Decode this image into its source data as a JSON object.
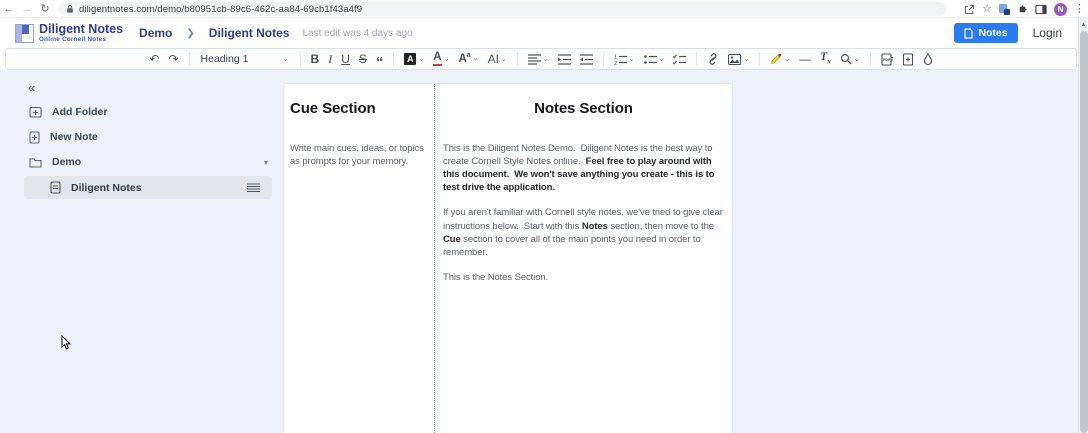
{
  "browser": {
    "url": "diligentnotes.com/demo/b80951cb-89c6-462c-aa84-69cb1f43a4f9",
    "back_glyph": "←",
    "forward_glyph": "→",
    "reload_glyph": "↻",
    "star_glyph": "☆",
    "menu_glyph": "⋮",
    "avatar_letter": "N"
  },
  "header": {
    "logo_title": "Diligent Notes",
    "logo_subtitle": "Online Cornell Notes",
    "breadcrumb": {
      "folder": "Demo",
      "separator": "❯",
      "note": "Diligent Notes"
    },
    "last_edit": "Last edit was 4 days ago",
    "notes_button_label": "Notes",
    "login_label": "Login"
  },
  "toolbar": {
    "undo_glyph": "↶",
    "redo_glyph": "↷",
    "chevron_glyph": "⌄",
    "heading_select_value": "Heading 1",
    "bold_glyph": "B",
    "italic_glyph": "I",
    "underline_glyph": "U",
    "strikethrough_glyph": "S",
    "blockquote_glyph": "“",
    "font_bg_glyph": "A",
    "font_color_glyph": "A",
    "font_size_main": "A",
    "font_size_sup": "a",
    "font_family_glyph": "AI",
    "hr_glyph": "—",
    "clear_format_main": "T",
    "clear_format_sub": "x"
  },
  "sidebar": {
    "collapse_glyph": "«",
    "add_folder_label": "Add Folder",
    "new_note_label": "New Note",
    "folder_label": "Demo",
    "folder_chevron_glyph": "▾",
    "note_label": "Diligent Notes"
  },
  "document": {
    "cue": {
      "heading": "Cue Section",
      "body": "Write main cues, ideas, or topics as prompts for your memory."
    },
    "notes": {
      "heading": "Notes Section",
      "paragraphs": [
        [
          {
            "text": "This is the Diligent Notes Demo.  Diligent Notes is the best way to create Cornell Style Notes online.  ",
            "bold": false
          },
          {
            "text": "Feel free to play around with this document.  We won't save anything you create - this is to test drive the application.",
            "bold": true
          }
        ],
        [
          {
            "text": "If you aren't familiar with Cornell style notes, we've tried to give clear instructions below.  Start with this ",
            "bold": false
          },
          {
            "text": "Notes",
            "bold": true
          },
          {
            "text": " section, then move to the ",
            "bold": false
          },
          {
            "text": "Cue",
            "bold": true
          },
          {
            "text": " section to cover all of the main points you need in order to remember.",
            "bold": false
          }
        ],
        [
          {
            "text": "This is the Notes Section.",
            "bold": false
          }
        ]
      ]
    }
  },
  "colors": {
    "accent_blue": "#2b7cf0",
    "logo_blue": "#2c3b9c",
    "avatar_purple": "#9a57c1",
    "content_bg": "#eef1f7",
    "selected_row_bg": "#e2e6eb"
  }
}
